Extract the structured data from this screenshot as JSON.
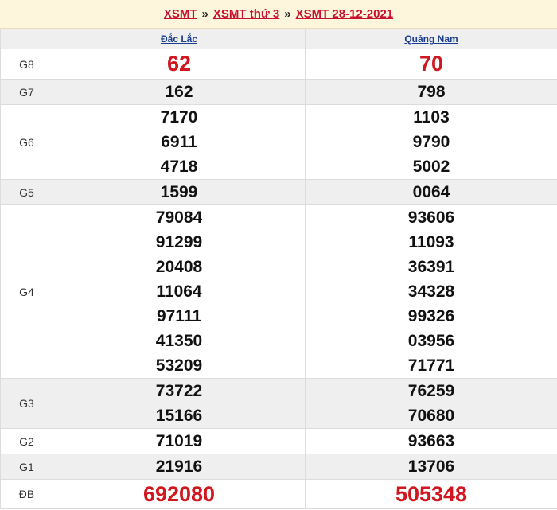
{
  "breadcrumb": {
    "item1": "XSMT",
    "item2": "XSMT thứ 3",
    "item3": "XSMT 28-12-2021",
    "sep": "»"
  },
  "provinces": [
    "Đắc Lắc",
    "Quảng Nam"
  ],
  "prizes": [
    {
      "label": "G8",
      "a": [
        "62"
      ],
      "b": [
        "70"
      ]
    },
    {
      "label": "G7",
      "a": [
        "162"
      ],
      "b": [
        "798"
      ]
    },
    {
      "label": "G6",
      "a": [
        "7170",
        "6911",
        "4718"
      ],
      "b": [
        "1103",
        "9790",
        "5002"
      ]
    },
    {
      "label": "G5",
      "a": [
        "1599"
      ],
      "b": [
        "0064"
      ]
    },
    {
      "label": "G4",
      "a": [
        "79084",
        "91299",
        "20408",
        "11064",
        "97111",
        "41350",
        "53209"
      ],
      "b": [
        "93606",
        "11093",
        "36391",
        "34328",
        "99326",
        "03956",
        "71771"
      ]
    },
    {
      "label": "G3",
      "a": [
        "73722",
        "15166"
      ],
      "b": [
        "76259",
        "70680"
      ]
    },
    {
      "label": "G2",
      "a": [
        "71019"
      ],
      "b": [
        "93663"
      ]
    },
    {
      "label": "G1",
      "a": [
        "21916"
      ],
      "b": [
        "13706"
      ]
    },
    {
      "label": "ĐB",
      "a": [
        "692080"
      ],
      "b": [
        "505348"
      ]
    }
  ],
  "colors": {
    "accent_red": "#d0161f",
    "header_bg": "#fdf6dc",
    "link_blue": "#1a3d8f"
  }
}
